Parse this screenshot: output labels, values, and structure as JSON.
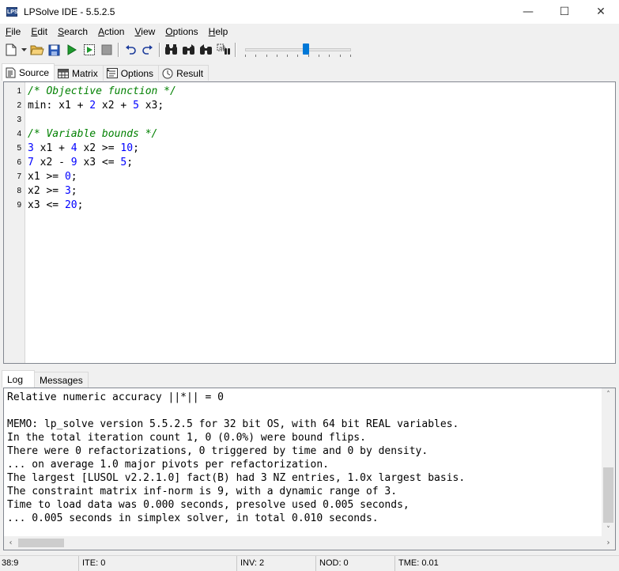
{
  "window": {
    "app_icon_text": "LPS",
    "title": "LPSolve IDE - 5.5.2.5",
    "minimize_glyph": "—",
    "maximize_glyph": "☐",
    "close_glyph": "✕"
  },
  "menu": [
    {
      "accel": "F",
      "rest": "ile"
    },
    {
      "accel": "E",
      "rest": "dit"
    },
    {
      "accel": "S",
      "rest": "earch"
    },
    {
      "accel": "A",
      "rest": "ction"
    },
    {
      "accel": "V",
      "rest": "iew"
    },
    {
      "accel": "O",
      "rest": "ptions"
    },
    {
      "accel": "H",
      "rest": "elp"
    }
  ],
  "toolbar": {
    "icons": [
      "new-file-icon",
      "dropdown-arrow-icon",
      "open-folder-icon",
      "save-icon",
      "run-icon",
      "step-icon",
      "stop-icon",
      "undo-icon",
      "redo-icon",
      "find-icon",
      "find-next-icon",
      "find-previous-icon",
      "replace-icon"
    ],
    "slider_value_pct": 58
  },
  "tabs_top": [
    {
      "label": "Source",
      "icon": "source-doc-icon",
      "active": true
    },
    {
      "label": "Matrix",
      "icon": "matrix-grid-icon",
      "active": false
    },
    {
      "label": "Options",
      "icon": "options-list-icon",
      "active": false
    },
    {
      "label": "Result",
      "icon": "result-clock-icon",
      "active": false
    }
  ],
  "editor": {
    "lines": [
      {
        "n": "1",
        "html_tokens": [
          [
            "comment",
            "/* Objective function */"
          ]
        ]
      },
      {
        "n": "2",
        "html_tokens": [
          [
            "kw",
            "min: x1 + "
          ],
          [
            "num",
            "2"
          ],
          [
            "kw",
            " x2 + "
          ],
          [
            "num",
            "5"
          ],
          [
            "kw",
            " x3;"
          ]
        ]
      },
      {
        "n": "3",
        "html_tokens": []
      },
      {
        "n": "4",
        "html_tokens": [
          [
            "comment",
            "/* Variable bounds */"
          ]
        ]
      },
      {
        "n": "5",
        "html_tokens": [
          [
            "num",
            "3"
          ],
          [
            "kw",
            " x1 + "
          ],
          [
            "num",
            "4"
          ],
          [
            "kw",
            " x2 >= "
          ],
          [
            "num",
            "10"
          ],
          [
            "kw",
            ";"
          ]
        ]
      },
      {
        "n": "6",
        "html_tokens": [
          [
            "num",
            "7"
          ],
          [
            "kw",
            " x2 - "
          ],
          [
            "num",
            "9"
          ],
          [
            "kw",
            " x3 <= "
          ],
          [
            "num",
            "5"
          ],
          [
            "kw",
            ";"
          ]
        ]
      },
      {
        "n": "7",
        "html_tokens": [
          [
            "kw",
            "x1 >= "
          ],
          [
            "num",
            "0"
          ],
          [
            "kw",
            ";"
          ]
        ]
      },
      {
        "n": "8",
        "html_tokens": [
          [
            "kw",
            "x2 >= "
          ],
          [
            "num",
            "3"
          ],
          [
            "kw",
            ";"
          ]
        ]
      },
      {
        "n": "9",
        "html_tokens": [
          [
            "kw",
            "x3 <= "
          ],
          [
            "num",
            "20"
          ],
          [
            "kw",
            ";"
          ]
        ]
      }
    ]
  },
  "tabs_bottom": [
    {
      "label": "Log",
      "active": true
    },
    {
      "label": "Messages",
      "active": false
    }
  ],
  "log": {
    "lines": [
      "Relative numeric accuracy ||*|| = 0",
      "",
      "MEMO: lp_solve version 5.5.2.5 for 32 bit OS, with 64 bit REAL variables.",
      "In the total iteration count 1, 0 (0.0%) were bound flips.",
      "There were 0 refactorizations, 0 triggered by time and 0 by density.",
      "... on average 1.0 major pivots per refactorization.",
      "The largest [LUSOL v2.2.1.0] fact(B) had 3 NZ entries, 1.0x largest basis.",
      "The constraint matrix inf-norm is 9, with a dynamic range of 3.",
      "Time to load data was 0.000 seconds, presolve used 0.005 seconds,",
      "... 0.005 seconds in simplex solver, in total 0.010 seconds."
    ],
    "scroll_up_glyph": "˄",
    "scroll_down_glyph": "˅",
    "scroll_left_glyph": "‹",
    "scroll_right_glyph": "›"
  },
  "status": {
    "position": "38:9",
    "ite": "ITE: 0",
    "inv": "INV: 2",
    "nod": "NOD: 0",
    "tme": "TME: 0.01"
  }
}
